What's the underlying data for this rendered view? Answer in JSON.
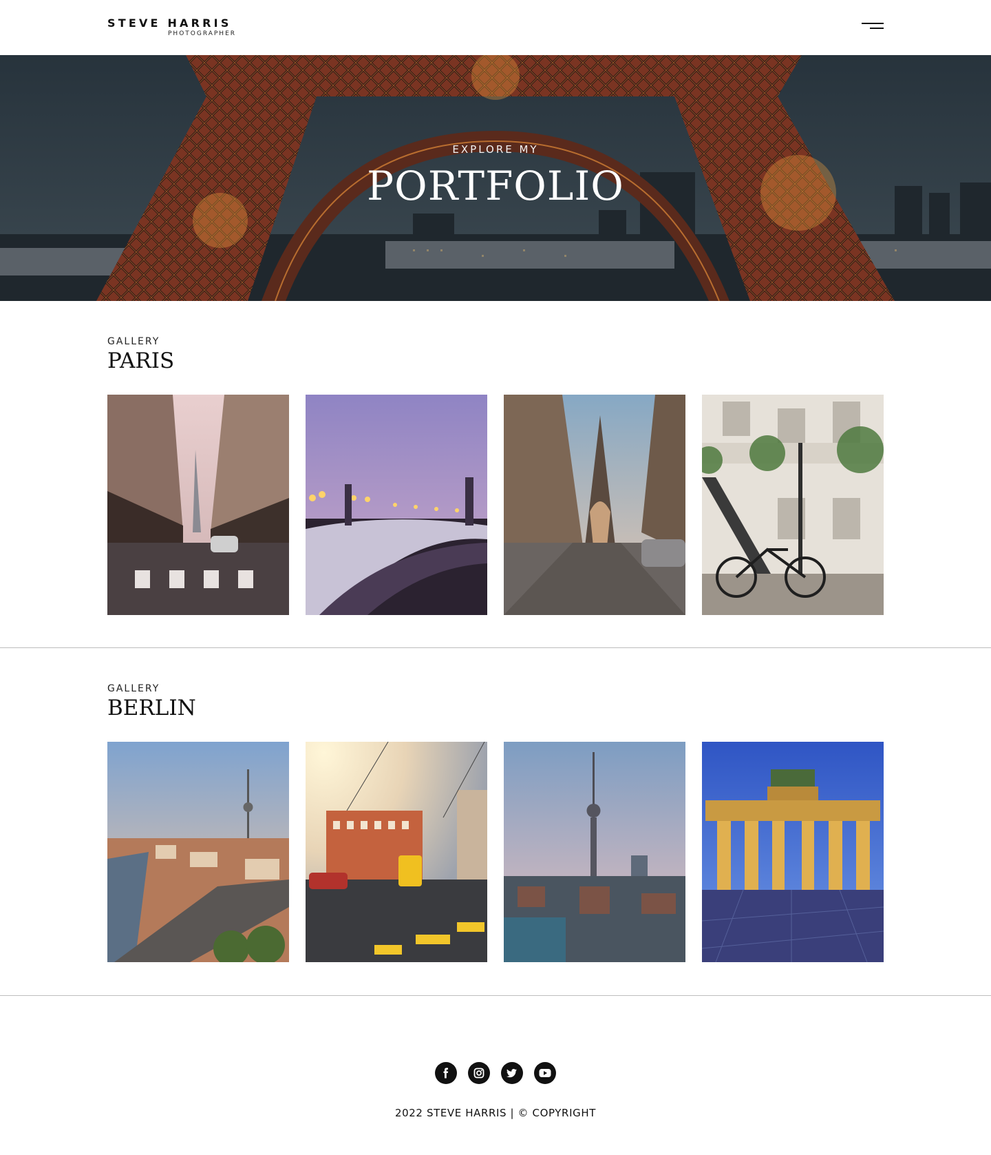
{
  "header": {
    "brand_name": "STEVE HARRIS",
    "brand_tagline": "PHOTOGRAPHER",
    "menu_icon": "hamburger-menu-icon"
  },
  "hero": {
    "subtitle": "EXPLORE MY",
    "title": "PORTFOLIO"
  },
  "galleries": [
    {
      "label": "GALLERY",
      "title": "PARIS",
      "photos": [
        "street-with-eiffel-tower",
        "bridge-at-dusk-with-lamps",
        "cobblestone-street-eiffel-tower",
        "bicycle-by-staircase"
      ]
    },
    {
      "label": "GALLERY",
      "title": "BERLIN",
      "photos": [
        "aerial-city-tv-tower",
        "yellow-tram-street",
        "tv-tower-skyline-dusk",
        "brandenburg-gate-night"
      ]
    }
  ],
  "footer": {
    "social_icons": [
      "facebook-icon",
      "instagram-icon",
      "twitter-icon",
      "youtube-icon"
    ],
    "copyright": "2022 STEVE HARRIS | © COPYRIGHT"
  },
  "colors": {
    "text": "#111111",
    "divider": "#bdbdbd",
    "hero_sky": "#2a3640",
    "tower_iron": "#a5472a"
  }
}
